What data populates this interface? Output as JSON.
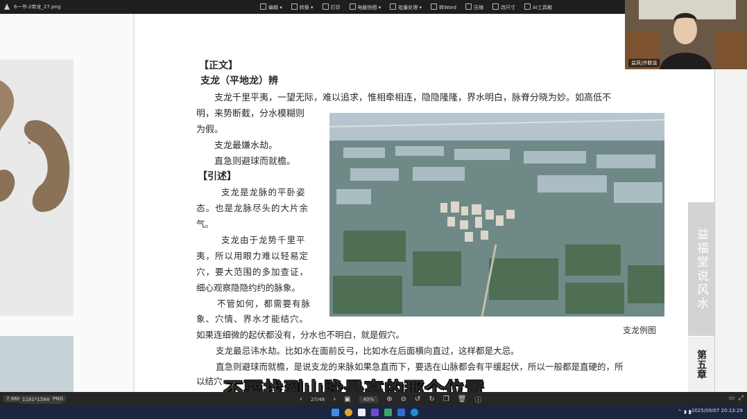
{
  "titlebar": {
    "filename": "6一书-2帝龙_27.png",
    "tools": [
      "编辑",
      "转换",
      "打印",
      "电脑快图",
      "批量处理",
      "转Word",
      "压缩",
      "改尺寸",
      "AI工具箱"
    ]
  },
  "page": {
    "section_heading": "【正文】",
    "sub_heading": "支龙（平地龙）辨",
    "lines": [
      "支龙千里平夷，一望无际，难以追求，惟相牵相连，隐隐隆隆，界水明白，脉脊分晓为妙。如高低不",
      "明，来势断截，分水模糊则",
      "为假。",
      "支龙最嫌水劫。",
      "直急则避球而就檐。"
    ],
    "quote_heading": "【引述】",
    "quote_lines": [
      "支龙是龙脉的平卧姿",
      "态。也是龙脉尽头的大片余",
      "气。",
      "支龙由于龙势千里平",
      "夷，所以用眼力难以轻易定",
      "穴，要大范围的多加查证，",
      "细心观察隐隐约约的脉象。",
      "不管如何，都需要有脉",
      "象、穴情、界水才能结穴。",
      "如果连细微的起伏都没有，分水也不明白，就是假穴。",
      "支龙最忌讳水劫。比如水在面前反弓，比如水在后面横向直过，这样都是大忌。",
      "直急则避球而就檐，是说支龙的来脉如果急直而下，要选在山脉都会有平缓起伏，所以一般都是直硬的，所",
      "以结穴"
    ],
    "photo_caption": "支龙例图",
    "side_tab": "益福堂说风水",
    "side_chapter": "第五章"
  },
  "webcam": {
    "label": "益风|许联谈"
  },
  "subtitle": "不要找到山脉最高的那个位置",
  "statusbar": {
    "filesize": "7.96M",
    "dimensions": "1181*1584像素",
    "format": "PNG",
    "page_indicator": "27/48",
    "zoom": "40%"
  },
  "clock": {
    "datetime": "2025/09/07 20:13:29"
  },
  "colors": {
    "subtitle_fill": "#f6e43a",
    "titlebar_bg": "#1e1e1e",
    "taskbar_bg": "#1c2540"
  }
}
